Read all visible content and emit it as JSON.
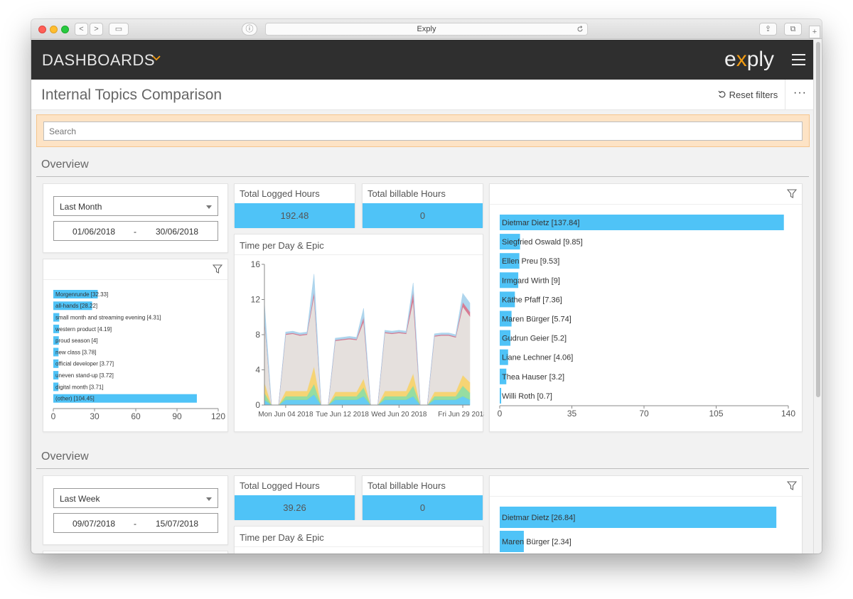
{
  "browser": {
    "address": "Exply",
    "nav_back": "<",
    "nav_forward": ">",
    "sidebar_toggle": "▭",
    "privacy_icon": "ⓘ",
    "share_icon": "⇪",
    "tabs_icon": "⧉",
    "new_tab": "+"
  },
  "appbar": {
    "title": "DASHBOARDS",
    "logo_pre": "e",
    "logo_x": "x",
    "logo_post": "ply"
  },
  "page": {
    "title": "Internal Topics Comparison",
    "reset_filters": "Reset filters",
    "more": "···"
  },
  "search": {
    "placeholder": "Search"
  },
  "colors": {
    "accent": "#4fc3f7",
    "brand_orange": "#f39c12",
    "appbar": "#2f2f2f"
  },
  "sections": [
    {
      "label": "Overview",
      "period": "Last Month",
      "date_from": "01/06/2018",
      "date_sep": "-",
      "date_to": "30/06/2018",
      "kpi_logged_label": "Total Logged Hours",
      "kpi_logged_value": "192.48",
      "kpi_billable_label": "Total billable Hours",
      "kpi_billable_value": "0",
      "time_chart_title": "Time per Day & Epic"
    },
    {
      "label": "Overview",
      "period": "Last Week",
      "date_from": "09/07/2018",
      "date_sep": "-",
      "date_to": "15/07/2018",
      "kpi_logged_label": "Total Logged Hours",
      "kpi_logged_value": "39.26",
      "kpi_billable_label": "Total billable Hours",
      "kpi_billable_value": "0",
      "time_chart_title": "Time per Day & Epic"
    }
  ],
  "chart_data": [
    {
      "type": "bar",
      "orientation": "horizontal",
      "categories": [
        "Morgenrunde [32.33]",
        "all-hands [28.22]",
        "small month and streaming evening [4.31]",
        "western product [4.19]",
        "proud season [4]",
        "new class [3.78]",
        "official developer [3.77]",
        "uneven stand-up [3.72]",
        "digital month [3.71]",
        "(other) [104.45]"
      ],
      "values": [
        32.33,
        28.22,
        4.31,
        4.19,
        4,
        3.78,
        3.77,
        3.72,
        3.71,
        104.45
      ],
      "xlim": [
        0,
        120
      ],
      "xticks": [
        "0",
        "30",
        "60",
        "90",
        "120"
      ]
    },
    {
      "type": "area",
      "title": "Time per Day & Epic",
      "x_ticks": [
        "Mon Jun 04 2018",
        "Tue Jun 12 2018",
        "Wed Jun 20 2018",
        "Fri Jun 29 2018"
      ],
      "yticks": [
        "0",
        "4",
        "8",
        "12",
        "16"
      ],
      "ylim": [
        0,
        16
      ],
      "stacked": true,
      "x": [
        "Jun 01",
        "Jun 02",
        "Jun 03",
        "Jun 04",
        "Jun 05",
        "Jun 06",
        "Jun 07",
        "Jun 08",
        "Jun 09",
        "Jun 10",
        "Jun 11",
        "Jun 12",
        "Jun 13",
        "Jun 14",
        "Jun 15",
        "Jun 16",
        "Jun 17",
        "Jun 18",
        "Jun 19",
        "Jun 20",
        "Jun 21",
        "Jun 22",
        "Jun 23",
        "Jun 24",
        "Jun 25",
        "Jun 26",
        "Jun 27",
        "Jun 28",
        "Jun 29",
        "Jun 30"
      ],
      "series": [
        {
          "color": "#5bc8f2",
          "values": [
            0.6,
            0,
            0,
            0.6,
            0.6,
            0.6,
            0.6,
            1.2,
            0,
            0,
            0.6,
            0.6,
            0.6,
            0.6,
            1.0,
            0,
            0,
            0.6,
            0.6,
            0.6,
            0.6,
            1.0,
            0,
            0,
            0.6,
            0.6,
            0.6,
            0.6,
            1.0,
            0.6
          ]
        },
        {
          "color": "#8edb9a",
          "values": [
            0.8,
            0,
            0,
            0.4,
            0.4,
            0.4,
            0.4,
            1.2,
            0,
            0,
            0.4,
            0.4,
            0.4,
            0.4,
            1.0,
            0,
            0,
            0.4,
            0.4,
            0.4,
            0.4,
            1.2,
            0,
            0,
            0.4,
            0.4,
            0.4,
            0.4,
            1.2,
            0.8
          ]
        },
        {
          "color": "#f6d169",
          "values": [
            1.2,
            0,
            0,
            0.6,
            0.6,
            0.6,
            0.6,
            2.0,
            0,
            0,
            0.5,
            0.5,
            0.5,
            0.5,
            1.0,
            0,
            0,
            0.6,
            0.6,
            0.6,
            0.6,
            1.4,
            0,
            0,
            0.5,
            0.5,
            0.5,
            0.5,
            1.2,
            1.2
          ]
        },
        {
          "color": "#e3dedb",
          "values": [
            7,
            0,
            0,
            6.4,
            6.5,
            6.3,
            6.4,
            8.0,
            0,
            0,
            5.8,
            5.9,
            6.0,
            5.9,
            6.5,
            0,
            0,
            6.6,
            6.5,
            6.6,
            6.5,
            8.3,
            0,
            0,
            6.3,
            6.4,
            6.4,
            6.2,
            7.8,
            7.5
          ]
        },
        {
          "color": "#d4718a",
          "values": [
            0.2,
            0,
            0,
            0.1,
            0.1,
            0.1,
            0.1,
            0.5,
            0,
            0,
            0.1,
            0.1,
            0.1,
            0.1,
            0.5,
            0,
            0,
            0.1,
            0.1,
            0.1,
            0.1,
            1.0,
            0,
            0,
            0.1,
            0.1,
            0.1,
            0.1,
            0.5,
            0.5
          ]
        },
        {
          "color": "#a8d2ec",
          "values": [
            1.8,
            0,
            0,
            0.2,
            0.2,
            0.2,
            0.2,
            2.0,
            0,
            0,
            0.2,
            0.2,
            0.2,
            0.2,
            1.0,
            0,
            0,
            0.2,
            0.2,
            0.2,
            0.2,
            1.0,
            0,
            0,
            0.2,
            0.2,
            0.2,
            0.2,
            1.0,
            1.0
          ]
        }
      ]
    },
    {
      "type": "bar",
      "orientation": "horizontal",
      "categories": [
        "Dietmar Dietz [137.84]",
        "Siegfried Oswald [9.85]",
        "Ellen Preu [9.53]",
        "Irmgard Wirth [9]",
        "Käthe Pfaff [7.36]",
        "Maren Bürger [5.74]",
        "Gudrun Geier [5.2]",
        "Liane Lechner [4.06]",
        "Thea Hauser [3.2]",
        "Willi Roth [0.7]"
      ],
      "values": [
        137.84,
        9.85,
        9.53,
        9,
        7.36,
        5.74,
        5.2,
        4.06,
        3.2,
        0.7
      ],
      "xlim": [
        0,
        140
      ],
      "xticks": [
        "0",
        "35",
        "70",
        "105",
        "140"
      ]
    },
    {
      "type": "bar",
      "orientation": "horizontal",
      "categories": [
        "Dietmar Dietz [26.84]",
        "Maren Bürger [2.34]"
      ],
      "values": [
        26.84,
        2.34
      ],
      "xlim": [
        0,
        28
      ]
    }
  ]
}
